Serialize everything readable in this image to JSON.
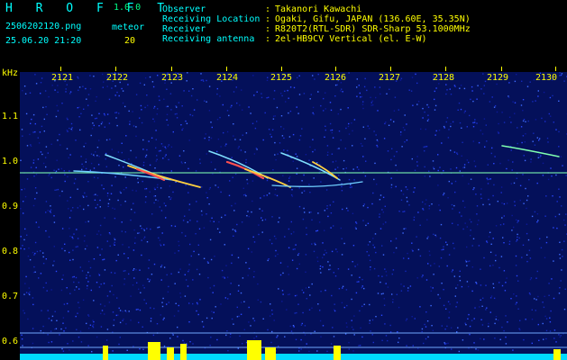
{
  "app": {
    "logo": "H R O F F T",
    "version": "1.0.0"
  },
  "file": {
    "name": "2506202120.png",
    "datetime": "25.06.20 21:20"
  },
  "meteor": {
    "label": "meteor",
    "count": "20"
  },
  "info": [
    {
      "key": "Observer",
      "value": "Takanori Kawachi"
    },
    {
      "key": "Receiving Location",
      "value": "Ogaki, Gifu, JAPAN (136.60E, 35.35N)"
    },
    {
      "key": "Receiver",
      "value": "R820T2(RTL-SDR) SDR-Sharp 53.1000MHz"
    },
    {
      "key": "Receiving antenna",
      "value": "2el-HB9CV Vertical (el. E-W)"
    }
  ],
  "axis": {
    "unit": "kHz",
    "y_ticks": [
      "1.1",
      "1.0",
      "0.9",
      "0.8",
      "0.7",
      "0.6"
    ],
    "x_ticks": [
      "2121",
      "2122",
      "2123",
      "2124",
      "2125",
      "2126",
      "2127",
      "2128",
      "2129",
      "2130"
    ]
  },
  "colors": {
    "label": "#00ffff",
    "value": "#ffff00",
    "noise": "#0a1a8c",
    "carrier": "#7fffb0"
  }
}
